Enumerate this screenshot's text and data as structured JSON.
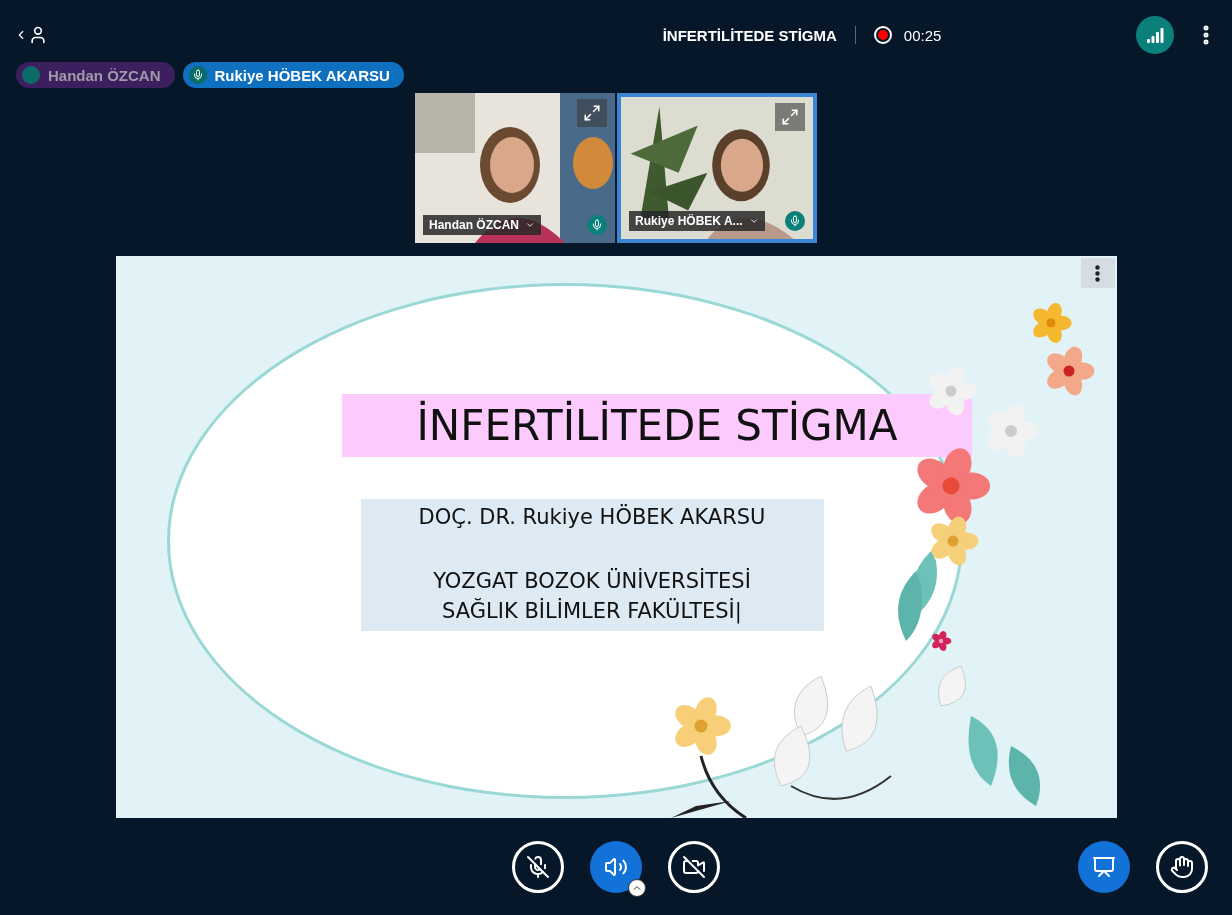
{
  "header": {
    "title": "İNFERTİLİTEDE STİGMA",
    "recording": true,
    "timer": "00:25"
  },
  "participants": [
    {
      "name": "Handan ÖZCAN",
      "talking": false
    },
    {
      "name": "Rukiye HÖBEK AKARSU",
      "talking": true
    }
  ],
  "videos": [
    {
      "name": "Handan ÖZCAN",
      "selected": false,
      "kind": "picture"
    },
    {
      "name": "Rukiye HÖBEK A...",
      "selected": true,
      "kind": "picture"
    }
  ],
  "slide": {
    "title": "İNFERTİLİTEDE STİGMA",
    "lines": [
      "DOÇ. DR. Rukiye HÖBEK AKARSU",
      "YOZGAT BOZOK ÜNİVERSİTESİ",
      "SAĞLIK BİLİMLER FAKÜLTESİ|"
    ]
  },
  "controls": [
    {
      "kind": "mic",
      "on": false
    },
    {
      "kind": "audio",
      "on": true
    },
    {
      "kind": "camera",
      "on": false
    }
  ],
  "right_controls": [
    {
      "kind": "presentation",
      "on": true
    },
    {
      "kind": "hand",
      "on": false
    }
  ]
}
